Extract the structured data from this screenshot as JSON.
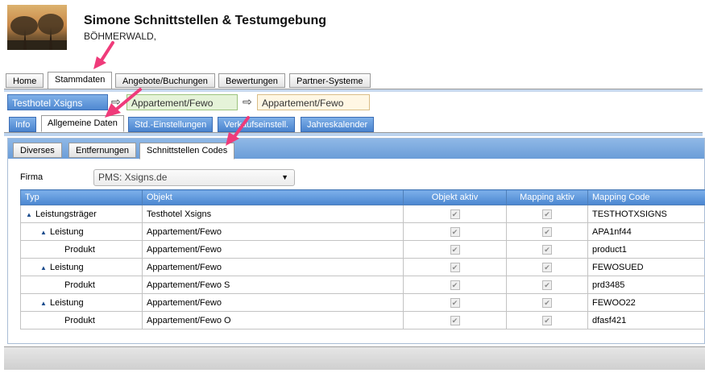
{
  "header": {
    "title": "Simone Schnittstellen & Testumgebung",
    "subtitle": "BÖHMERWALD,"
  },
  "top_tabs": [
    "Home",
    "Stammdaten",
    "Angebote/Buchungen",
    "Bewertungen",
    "Partner-Systeme"
  ],
  "active_top_tab": "Stammdaten",
  "breadcrumb": [
    "Testhotel Xsigns",
    "Appartement/Fewo",
    "Appartement/Fewo"
  ],
  "sub_tabs": [
    "Info",
    "Allgemeine Daten",
    "Std.-Einstellungen",
    "Verkaufseinstell.",
    "Jahreskalender"
  ],
  "active_sub_tab": "Allgemeine Daten",
  "panel_tabs": [
    "Diverses",
    "Entfernungen",
    "Schnittstellen Codes"
  ],
  "active_panel_tab": "Schnittstellen Codes",
  "firma": {
    "label": "Firma",
    "value": "PMS: Xsigns.de"
  },
  "table": {
    "columns": [
      "Typ",
      "Objekt",
      "Objekt aktiv",
      "Mapping aktiv",
      "Mapping Code"
    ],
    "rows": [
      {
        "typ": "Leistungsträger",
        "objekt": "Testhotel Xsigns",
        "mapping_code": "TESTHOTXSIGNS"
      },
      {
        "typ": "Leistung",
        "objekt": "Appartement/Fewo",
        "mapping_code": "APA1nf44"
      },
      {
        "typ": "Produkt",
        "objekt": "Appartement/Fewo",
        "mapping_code": "product1"
      },
      {
        "typ": "Leistung",
        "objekt": "Appartement/Fewo",
        "mapping_code": "FEWOSUED"
      },
      {
        "typ": "Produkt",
        "objekt": "Appartement/Fewo S",
        "mapping_code": "prd3485"
      },
      {
        "typ": "Leistung",
        "objekt": "Appartement/Fewo",
        "mapping_code": "FEWOO22"
      },
      {
        "typ": "Produkt",
        "objekt": "Appartement/Fewo O",
        "mapping_code": "dfasf421"
      }
    ]
  },
  "icons": {
    "expand": "caret-up-icon",
    "check": "checkmark-icon",
    "select": "chevron-down-icon",
    "breadcrumb_separator": "arrow-right-icon",
    "annotation": "pink-arrow-icon"
  },
  "colors": {
    "tab_blue": "#4a84cf",
    "breadcrumb_green": "#e5f3d8",
    "breadcrumb_orange": "#fff7e4",
    "annotation_pink": "#ef3b7a"
  }
}
